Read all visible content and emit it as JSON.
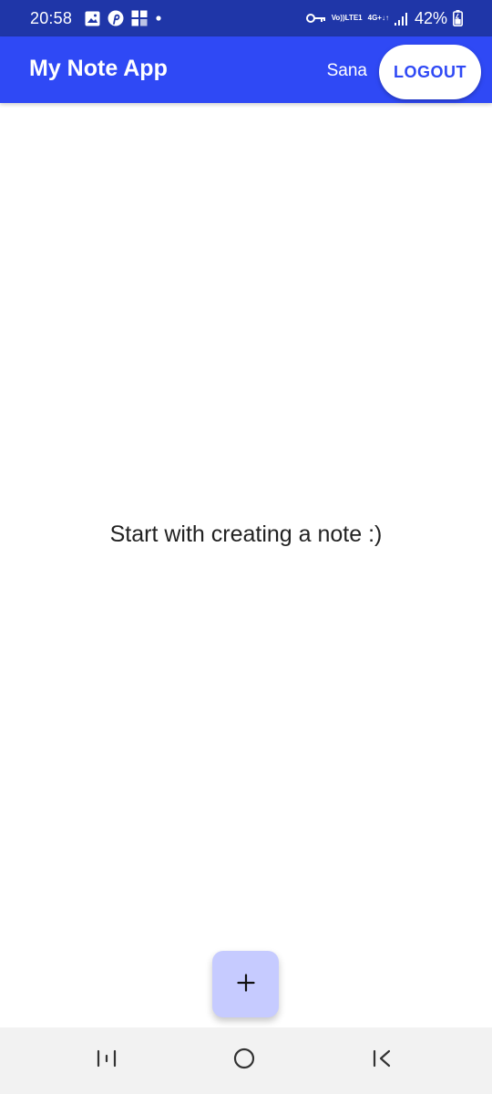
{
  "status_bar": {
    "time": "20:58",
    "left_icons": [
      "image-icon",
      "pinterest-icon",
      "grid-app-icon",
      "dot-icon"
    ],
    "right_icons": [
      "vpn-key-icon",
      "volte-icon",
      "4g-icon",
      "signal-icon",
      "battery-icon"
    ],
    "volte_top": "Vo))",
    "volte_bottom": "LTE1",
    "network_top": "4G+",
    "network_bottom": "↓↑",
    "battery": "42%"
  },
  "app_bar": {
    "title": "My Note App",
    "user": "Sana",
    "logout_label": "LOGOUT"
  },
  "content": {
    "empty_message": "Start with creating a note :)"
  },
  "fab": {
    "icon": "plus-icon"
  },
  "nav_bar": {
    "icons": [
      "recent-apps-icon",
      "home-icon",
      "back-icon"
    ]
  },
  "colors": {
    "status_bar": "#1f36a8",
    "app_bar": "#2f49f5",
    "fab": "#c6cbff",
    "nav_bar": "#f2f2f2"
  }
}
